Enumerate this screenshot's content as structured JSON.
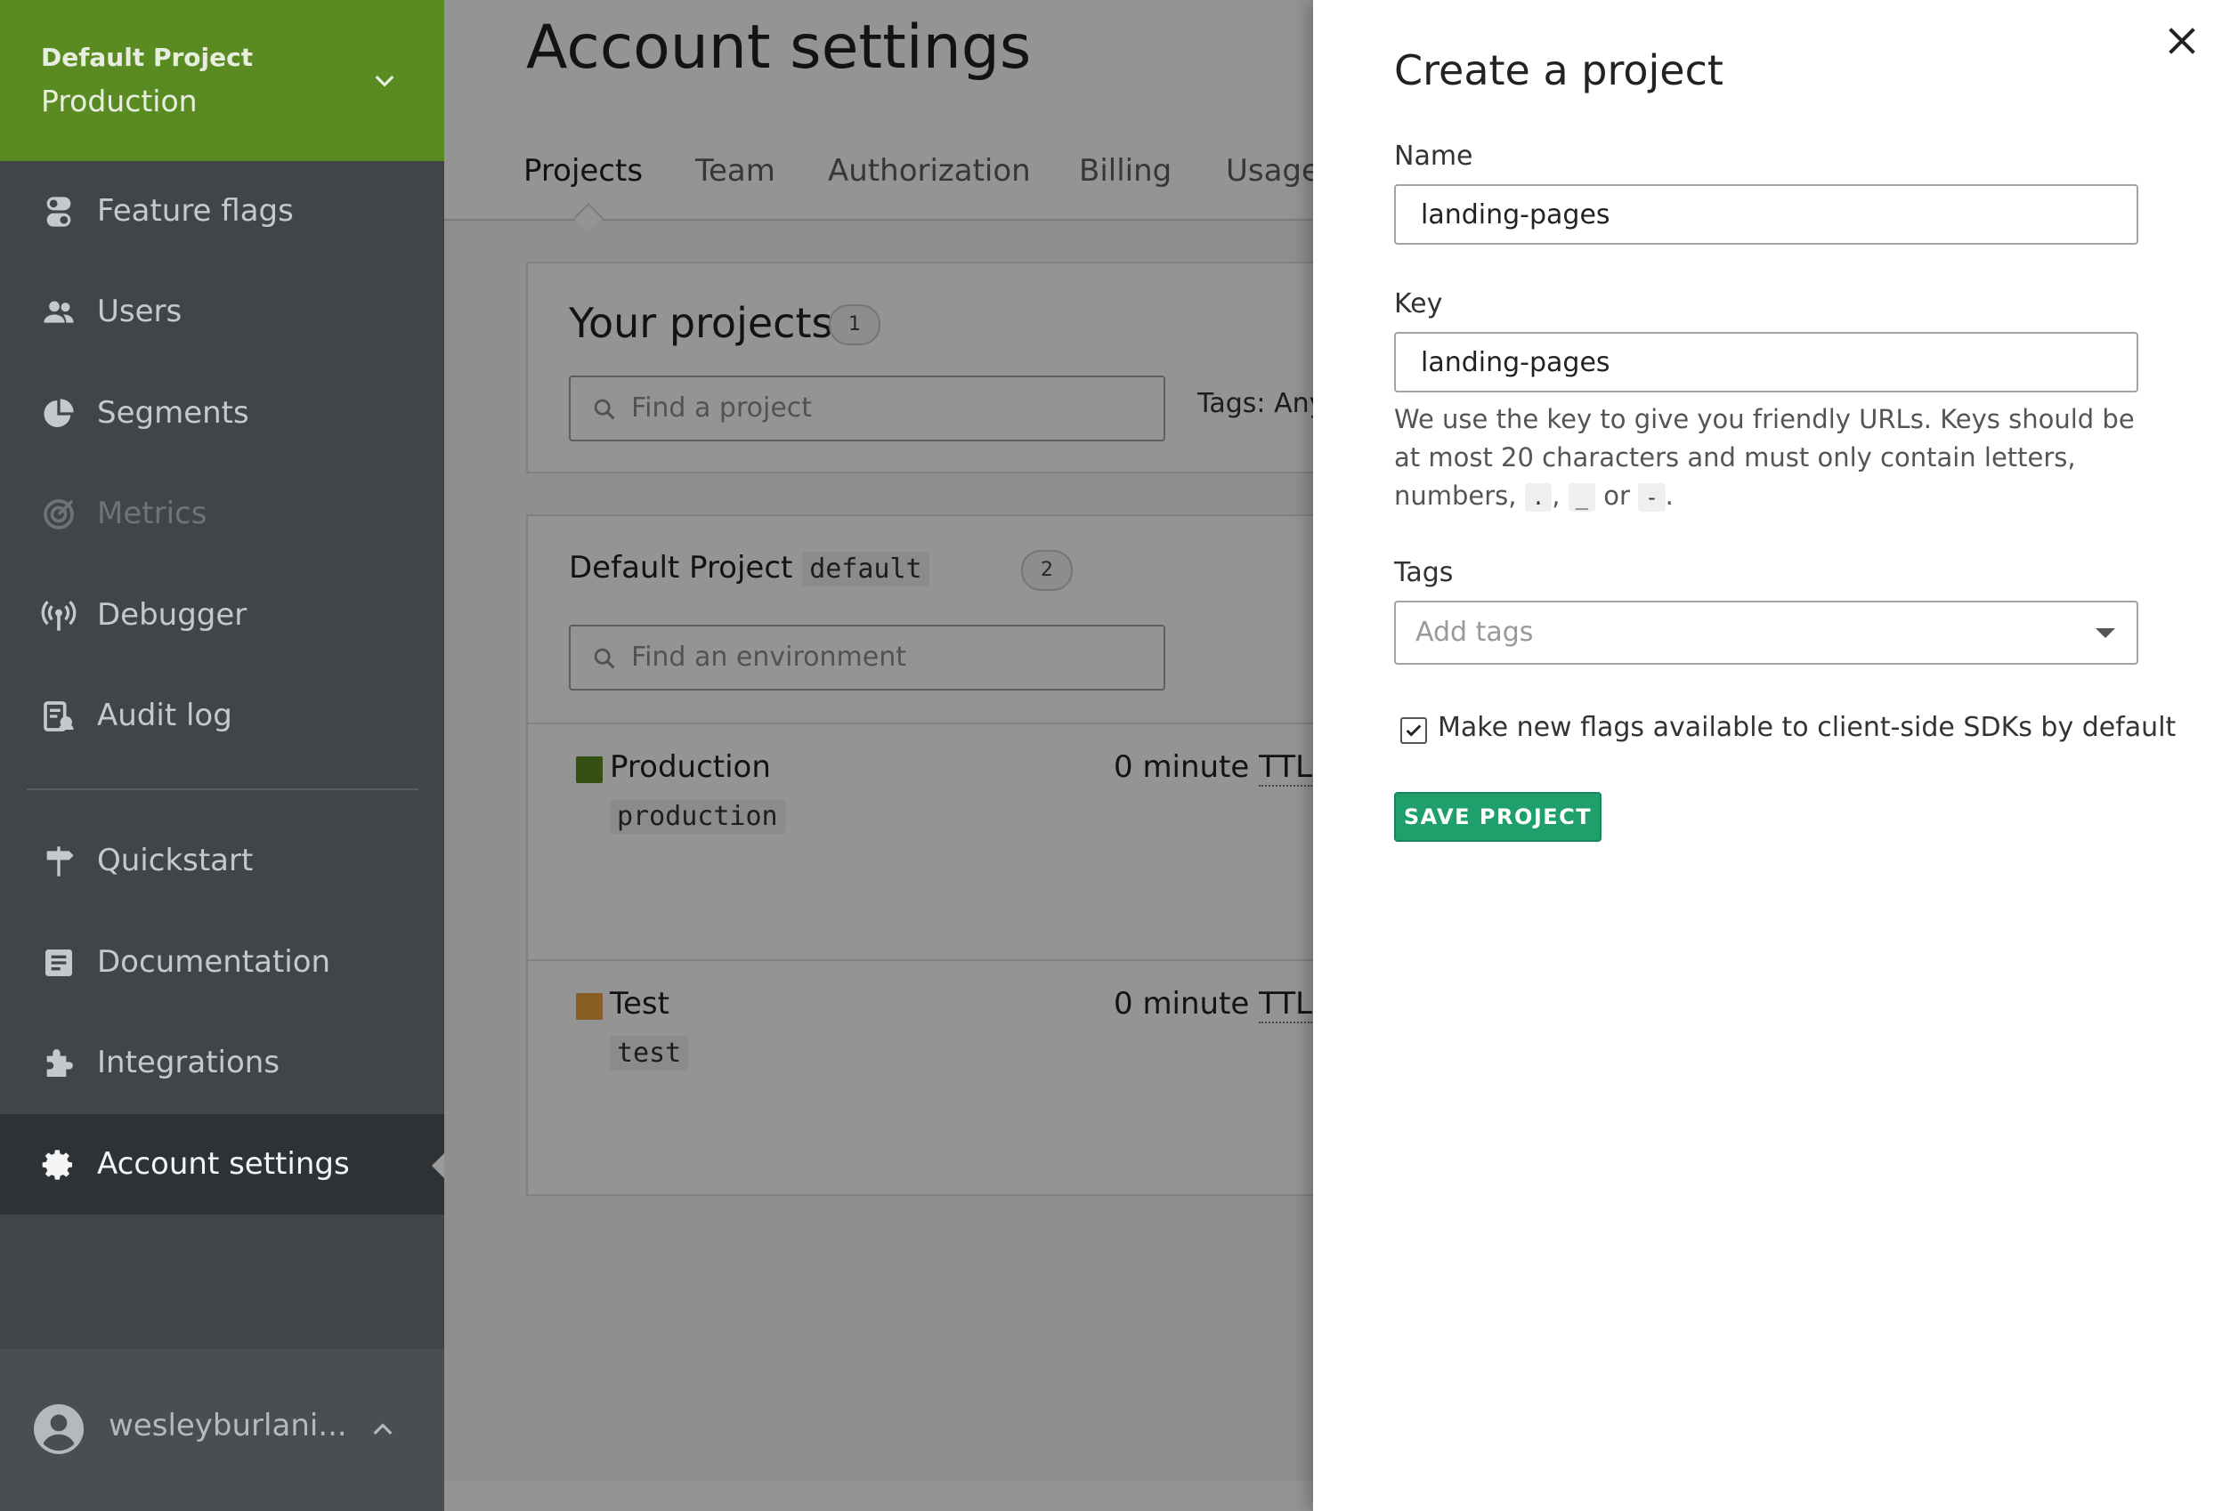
{
  "sidebar": {
    "project_switcher": {
      "project": "Default Project",
      "environment": "Production"
    },
    "items": [
      {
        "label": "Feature flags",
        "icon": "toggle-icon"
      },
      {
        "label": "Users",
        "icon": "users-icon"
      },
      {
        "label": "Segments",
        "icon": "pie-chart-icon"
      },
      {
        "label": "Metrics",
        "icon": "target-icon"
      },
      {
        "label": "Debugger",
        "icon": "broadcast-icon"
      },
      {
        "label": "Audit log",
        "icon": "audit-log-icon"
      },
      {
        "label": "Quickstart",
        "icon": "signpost-icon"
      },
      {
        "label": "Documentation",
        "icon": "document-icon"
      },
      {
        "label": "Integrations",
        "icon": "puzzle-icon"
      },
      {
        "label": "Account settings",
        "icon": "gear-icon"
      }
    ],
    "user": {
      "name": "wesleyburlani..."
    }
  },
  "main": {
    "title": "Account settings",
    "tabs": [
      "Projects",
      "Team",
      "Authorization",
      "Billing",
      "Usage"
    ],
    "active_tab": "Projects",
    "your_projects": {
      "title": "Your projects",
      "count": "1",
      "search_placeholder": "Find a project",
      "tags_label": "Tags:",
      "tags_value": "Any"
    },
    "project": {
      "name": "Default Project",
      "key": "default",
      "env_count": "2",
      "env_search_placeholder": "Find an environment",
      "environments": [
        {
          "name": "Production",
          "key": "production",
          "ttl_prefix": "0 minute",
          "ttl_abbr": "TTL",
          "color": "#5a8a22"
        },
        {
          "name": "Test",
          "key": "test",
          "ttl_prefix": "0 minute",
          "ttl_abbr": "TTL",
          "color": "#e8a33d"
        }
      ]
    }
  },
  "drawer": {
    "title": "Create a project",
    "name_label": "Name",
    "name_value": "landing-pages",
    "key_label": "Key",
    "key_value": "landing-pages",
    "help_text_1": "We use the key to give you friendly URLs. Keys should be at most 20 characters and must only contain letters, numbers,",
    "help_code_1": ".",
    "help_code_2": "_",
    "help_or": "or",
    "help_code_3": "-",
    "tags_label": "Tags",
    "tags_placeholder": "Add tags",
    "checkbox_label": "Make new flags available to client-side SDKs by default",
    "checkbox_checked": true,
    "save_label": "SAVE PROJECT"
  },
  "colors": {
    "project_header": "#5a8a22",
    "sidebar": "#414548",
    "primary_button": "#1f9f6c"
  }
}
